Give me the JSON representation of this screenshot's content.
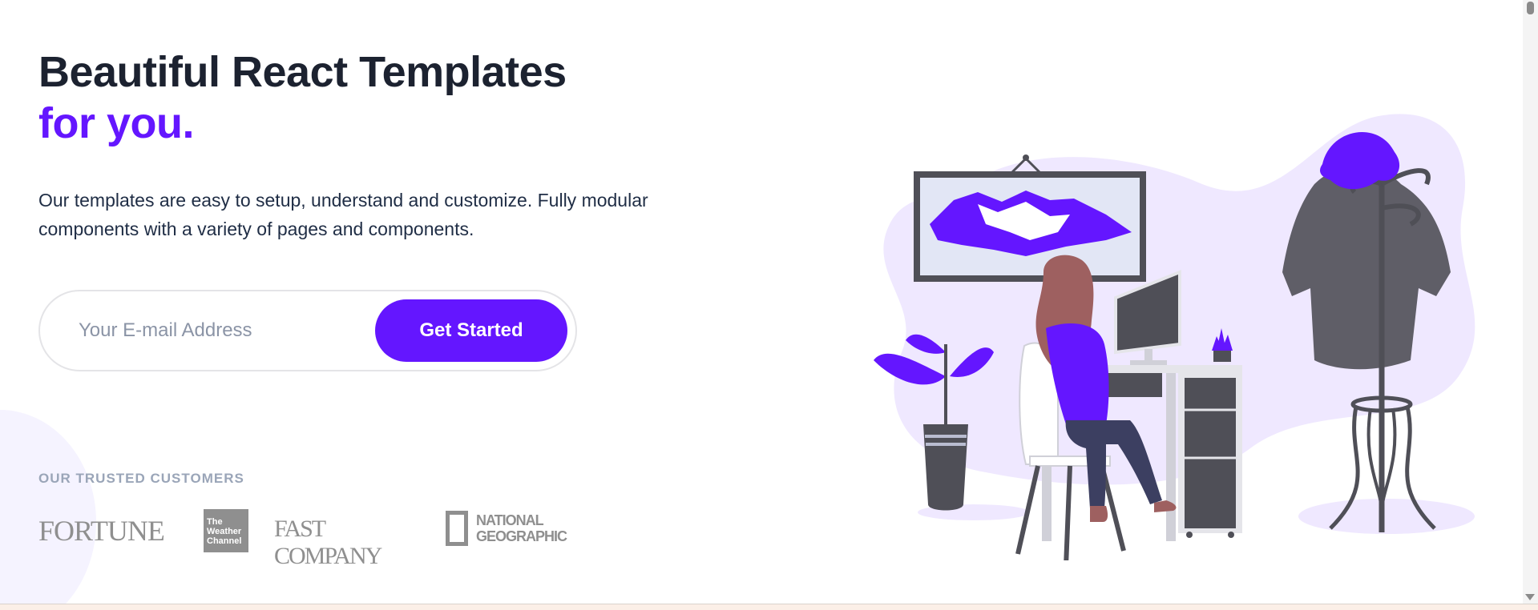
{
  "hero": {
    "title_line1": "Beautiful React Templates",
    "title_line2": "for you.",
    "description": "Our templates are easy to setup, understand and customize. Fully modular components with a variety of pages and components."
  },
  "signup": {
    "email_placeholder": "Your E-mail Address",
    "email_value": "",
    "cta_label": "Get Started"
  },
  "customers": {
    "heading": "OUR TRUSTED CUSTOMERS",
    "logos": [
      {
        "name": "fortune",
        "text": "FORTUNE"
      },
      {
        "name": "weather-channel",
        "text_lines": [
          "The",
          "Weather",
          "Channel"
        ]
      },
      {
        "name": "fast-company",
        "text": "FAST COMPANY"
      },
      {
        "name": "national-geographic",
        "text_lines": [
          "NATIONAL",
          "GEOGRAPHIC"
        ]
      }
    ]
  },
  "colors": {
    "accent": "#6416ff",
    "heading": "#1c2230",
    "body_text": "#1f2d45",
    "muted": "#9aa5b8",
    "illustration_bg": "#efe8ff",
    "illustration_dark": "#4f4f57"
  },
  "icons": {
    "illustration": "person-at-desk-illustration",
    "scroll_down": "chevron-down-icon"
  }
}
